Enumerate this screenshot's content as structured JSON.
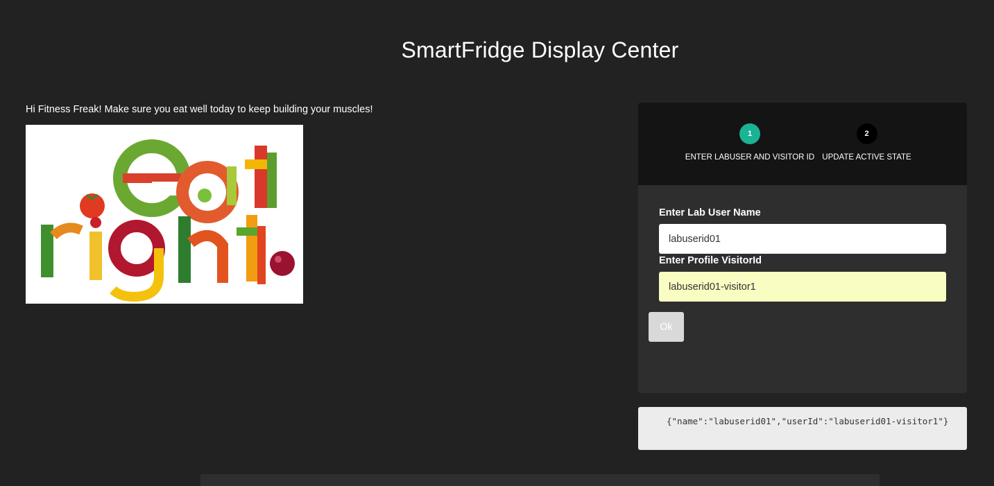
{
  "header": {
    "title": "SmartFridge Display Center"
  },
  "greeting": {
    "text": "Hi Fitness Freak! Make sure you eat well today to keep building your muscles!"
  },
  "hero_image": {
    "alt": "eat right"
  },
  "wizard": {
    "steps": [
      {
        "number": "1",
        "label": "ENTER LABUSER AND VISITOR ID",
        "state": "active"
      },
      {
        "number": "2",
        "label": "UPDATE ACTIVE STATE",
        "state": "pending"
      }
    ],
    "form": {
      "name_label": "Enter Lab User Name",
      "name_value": "labuserid01",
      "visitor_label": "Enter Profile VisitorId",
      "visitor_value": "labuserid01-visitor1",
      "ok_label": "Ok"
    }
  },
  "output": {
    "json_text": "{\"name\":\"labuserid01\",\"userId\":\"labuserid01-visitor1\"}"
  },
  "colors": {
    "background": "#222222",
    "active_step": "#1ab394",
    "autofill": "#fafdc2"
  }
}
